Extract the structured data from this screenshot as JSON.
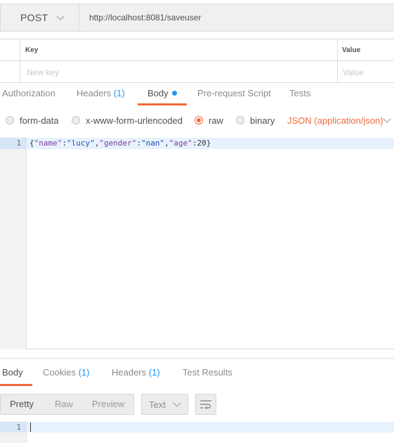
{
  "request": {
    "method": "POST",
    "url": "http://localhost:8081/saveuser"
  },
  "params": {
    "key_header": "Key",
    "value_header": "Value",
    "key_placeholder": "New key",
    "value_placeholder": "Value"
  },
  "request_tabs": {
    "authorization": "Authorization",
    "headers": "Headers",
    "headers_count": "(1)",
    "body": "Body",
    "prerequest": "Pre-request Script",
    "tests": "Tests"
  },
  "body_types": {
    "form_data": "form-data",
    "urlencoded": "x-www-form-urlencoded",
    "raw": "raw",
    "binary": "binary",
    "selected": "raw",
    "content_type": "JSON (application/json)"
  },
  "editor": {
    "line_numbers": [
      "1"
    ],
    "tokens": [
      "{",
      "\"name\"",
      ":",
      "\"lucy\"",
      ",",
      "\"gender\"",
      ":",
      "\"nan\"",
      ",",
      "\"age\"",
      ":",
      "20",
      "}"
    ]
  },
  "response_tabs": {
    "body": "Body",
    "cookies": "Cookies",
    "cookies_count": "(1)",
    "headers": "Headers",
    "headers_count": "(1)",
    "test_results": "Test Results"
  },
  "response_view": {
    "pretty": "Pretty",
    "raw": "Raw",
    "preview": "Preview",
    "format": "Text",
    "line_numbers": [
      "1"
    ]
  },
  "colors": {
    "accent": "#f26b3a",
    "count_blue": "#2196f3"
  }
}
